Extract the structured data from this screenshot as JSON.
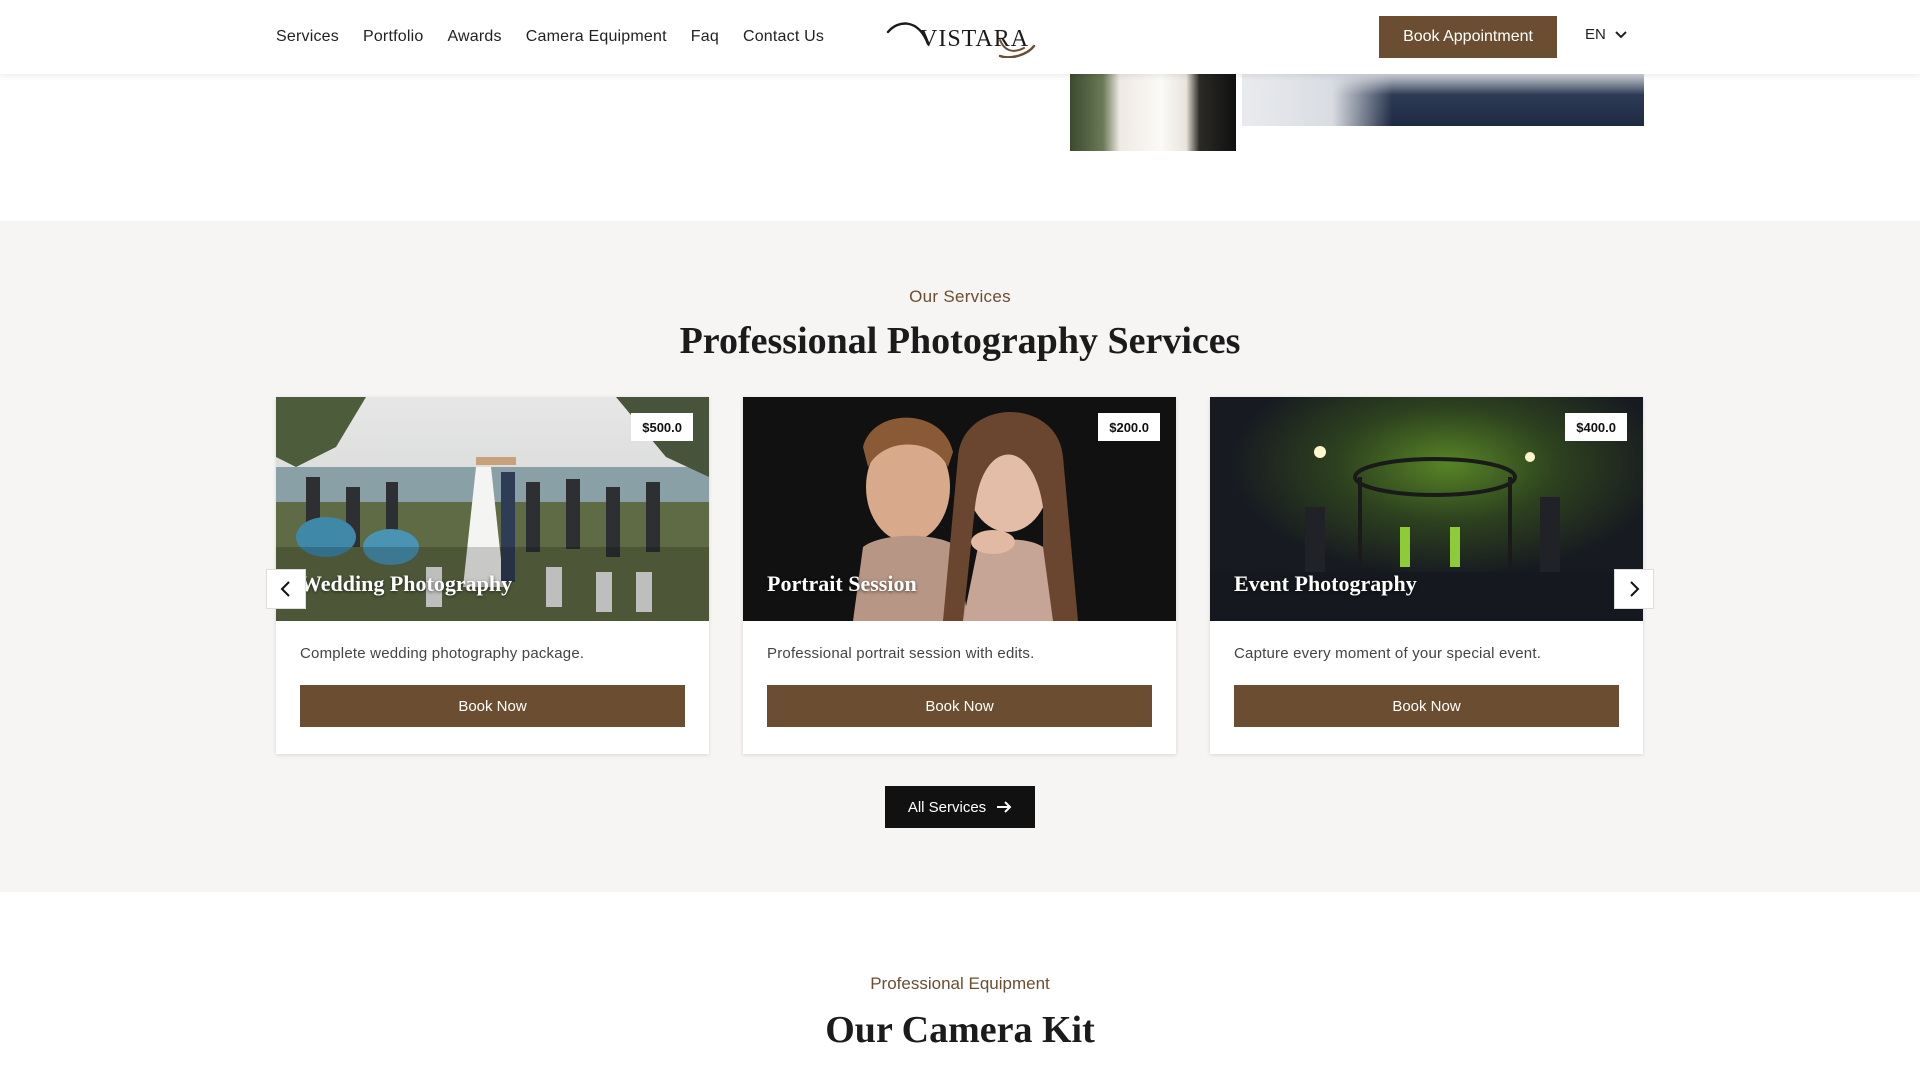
{
  "header": {
    "nav": [
      "Services",
      "Portfolio",
      "Awards",
      "Camera Equipment",
      "Faq",
      "Contact Us"
    ],
    "logo_text": "VISTARA",
    "book_appointment_label": "Book Appointment",
    "language": "EN"
  },
  "services": {
    "eyebrow": "Our Services",
    "title": "Professional Photography Services",
    "cards": [
      {
        "title": "Wedding Photography",
        "price": "$500.0",
        "description": "Complete wedding photography package.",
        "button": "Book Now"
      },
      {
        "title": "Portrait Session",
        "price": "$200.0",
        "description": "Professional portrait session with edits.",
        "button": "Book Now"
      },
      {
        "title": "Event Photography",
        "price": "$400.0",
        "description": "Capture every moment of your special event.",
        "button": "Book Now"
      }
    ],
    "all_services_label": "All Services"
  },
  "equipment": {
    "eyebrow": "Professional Equipment",
    "title": "Our Camera Kit"
  },
  "colors": {
    "brand": "#6b4e31",
    "section_bg": "#f6f5f3",
    "dark_button": "#111111"
  },
  "icons": {
    "prev": "chevron-left-icon",
    "next": "chevron-right-icon",
    "language_dropdown": "chevron-down-icon",
    "all_services": "arrow-right-icon"
  }
}
